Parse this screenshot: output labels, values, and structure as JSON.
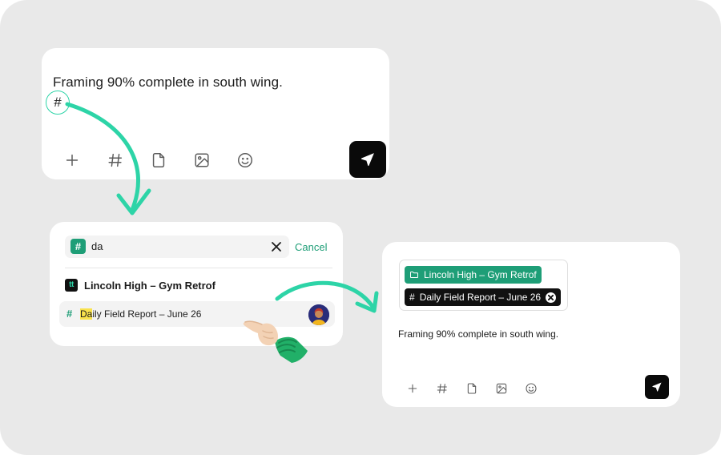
{
  "composer_top": {
    "message": "Framing 90% complete in south wing.",
    "hash_trigger": "#",
    "toolbar": [
      "plus-icon",
      "hash-icon",
      "file-icon",
      "image-icon",
      "emoji-icon"
    ],
    "send_icon": "send-icon"
  },
  "picker": {
    "search_badge": "#",
    "search_value": "da",
    "cancel_label": "Cancel",
    "project_logo": "tt",
    "project_name": "Lincoln High – Gym Retrof",
    "result": {
      "hash": "#",
      "highlight": "Da",
      "rest": "ily Field Report – June 26"
    }
  },
  "composer_bottom": {
    "chips": {
      "project": "Lincoln High – Gym Retrof",
      "report_hash": "#",
      "report": "Daily Field Report – June 26"
    },
    "message": "Framing 90% complete in south wing.",
    "toolbar": [
      "plus-icon",
      "hash-icon",
      "file-icon",
      "image-icon",
      "emoji-icon"
    ],
    "send_icon": "send-icon"
  },
  "colors": {
    "accent_green": "#1e9e77",
    "arrow_mint": "#2dd4a7",
    "highlight_yellow": "#f9e24d",
    "background": "#e9e9e9"
  }
}
